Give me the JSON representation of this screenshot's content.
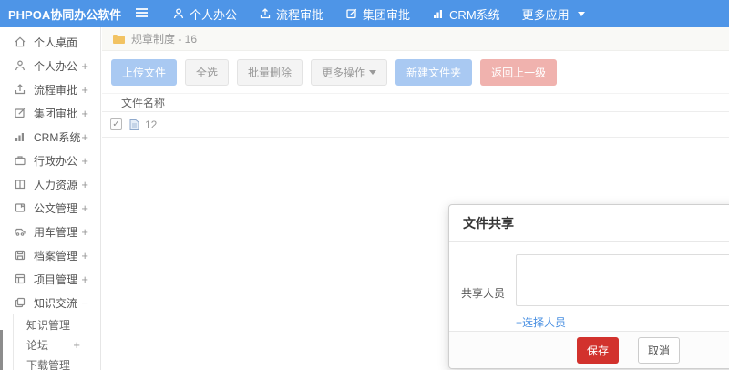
{
  "colors": {
    "topbar_bg": "#4e95e7",
    "accent_blue": "#4a90e2",
    "light_blue_button": "#a9c9f2",
    "light_red_button": "#f0b2ae",
    "save_red": "#d2322d",
    "folder_yellow": "#f2c363"
  },
  "topbar": {
    "logo": "PHPOA协同办公软件",
    "items": [
      {
        "label": "个人办公"
      },
      {
        "label": "流程审批"
      },
      {
        "label": "集团审批"
      },
      {
        "label": "CRM系统"
      },
      {
        "label": "更多应用"
      }
    ]
  },
  "sidebar": {
    "items": [
      {
        "label": "个人桌面",
        "sign": ""
      },
      {
        "label": "个人办公",
        "sign": "+"
      },
      {
        "label": "流程审批",
        "sign": "+"
      },
      {
        "label": "集团审批",
        "sign": "+"
      },
      {
        "label": "CRM系统",
        "sign": "+"
      },
      {
        "label": "行政办公",
        "sign": "+"
      },
      {
        "label": "人力资源",
        "sign": "+"
      },
      {
        "label": "公文管理",
        "sign": "+"
      },
      {
        "label": "用车管理",
        "sign": "+"
      },
      {
        "label": "档案管理",
        "sign": "+"
      },
      {
        "label": "项目管理",
        "sign": "+"
      },
      {
        "label": "知识交流",
        "sign": "−"
      }
    ],
    "subitems": [
      {
        "label": "知识管理",
        "sign": ""
      },
      {
        "label": "论坛",
        "sign": "+"
      },
      {
        "label": "下载管理",
        "sign": ""
      }
    ]
  },
  "breadcrumb": {
    "label": "规章制度 - 16"
  },
  "toolbar": {
    "upload": "上传文件",
    "select_all": "全选",
    "batch_delete": "批量删除",
    "more_actions": "更多操作",
    "new_folder": "新建文件夹",
    "go_back": "返回上一级"
  },
  "file_table": {
    "header": "文件名称",
    "rows": [
      {
        "name": "12",
        "checked": true
      }
    ]
  },
  "modal": {
    "title": "文件共享",
    "share_label": "共享人员",
    "textarea_value": "",
    "select_link": "+选择人员",
    "save": "保存",
    "cancel": "取消"
  }
}
